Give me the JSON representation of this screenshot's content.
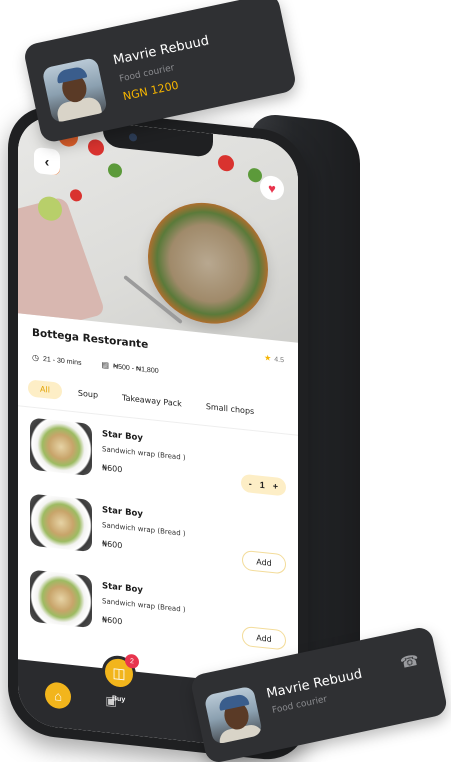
{
  "courier_top": {
    "name": "Mavrie Rebuud",
    "role": "Food courier",
    "amount": "NGN 1200"
  },
  "courier_bottom": {
    "name": "Mavrie Rebuud",
    "role": "Food courier",
    "phone_icon": "phone-icon"
  },
  "restaurant": {
    "name": "Bottega Restorante",
    "rating": "4.5",
    "delivery_time": "21 - 30 mins",
    "price_range": "₦500 - ₦1,800"
  },
  "categories": [
    "All",
    "Soup",
    "Takeaway Pack",
    "Small chops"
  ],
  "products": [
    {
      "name": "Star Boy",
      "desc": "Sandwich wrap (Bread )",
      "price": "₦600",
      "qty": "1",
      "minus": "-",
      "plus": "+"
    },
    {
      "name": "Star Boy",
      "desc": "Sandwich wrap (Bread )",
      "price": "₦600",
      "action": "Add"
    },
    {
      "name": "Star Boy",
      "desc": "Sandwich wrap (Bread )",
      "price": "₦600",
      "action": "Add"
    }
  ],
  "nav": {
    "cart_badge": "2",
    "buy_label": "Buy"
  },
  "colors": {
    "accent": "#f2b51c",
    "accent_light": "#fdeec6",
    "dark": "#2a2b2e",
    "heart": "#e8344d"
  }
}
